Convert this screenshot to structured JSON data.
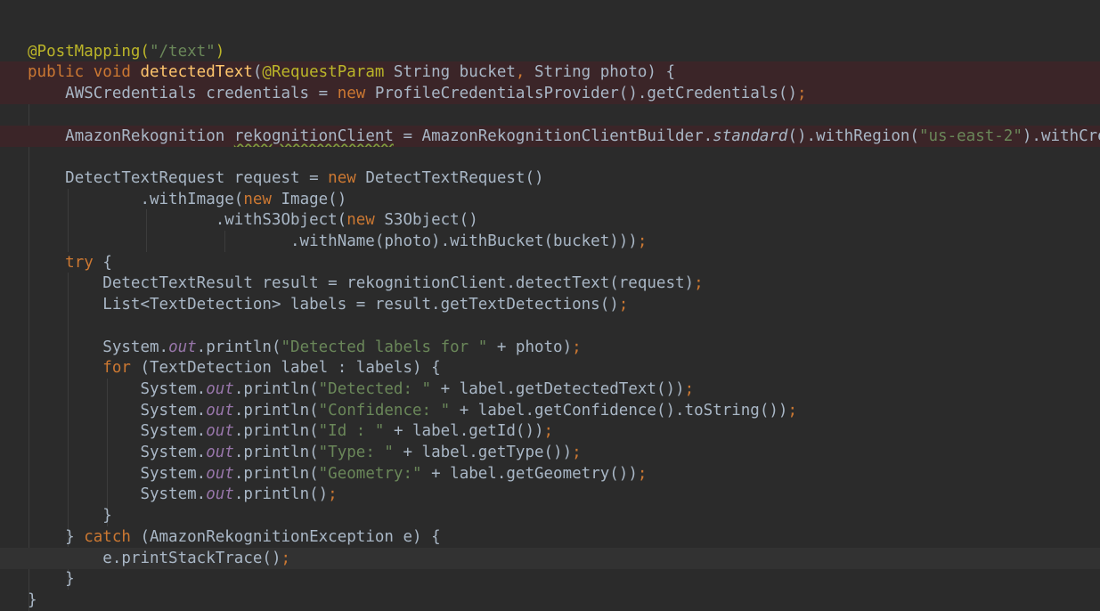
{
  "editor": {
    "lines": [
      {
        "indent": "",
        "tokens": []
      },
      {
        "indent": "",
        "tokens": [
          {
            "t": "@PostMapping(",
            "c": "ann"
          },
          {
            "t": "\"/text\"",
            "c": "str"
          },
          {
            "t": ")",
            "c": "ann"
          }
        ]
      },
      {
        "indent": "",
        "hl": "err",
        "tokens": [
          {
            "t": "public void ",
            "c": "kw"
          },
          {
            "t": "detectedText",
            "c": "fn"
          },
          {
            "t": "(",
            "c": ""
          },
          {
            "t": "@RequestParam",
            "c": "ann"
          },
          {
            "t": " String bucket",
            "c": ""
          },
          {
            "t": ", ",
            "c": "kw"
          },
          {
            "t": "String photo) {",
            "c": ""
          }
        ]
      },
      {
        "indent": "    ",
        "hl": "err",
        "tokens": [
          {
            "t": "AWSCredentials credentials = ",
            "c": ""
          },
          {
            "t": "new ",
            "c": "kw"
          },
          {
            "t": "ProfileCredentialsProvider().getCredentials()",
            "c": ""
          },
          {
            "t": ";",
            "c": "kw"
          }
        ]
      },
      {
        "indent": "",
        "tokens": []
      },
      {
        "indent": "    ",
        "hl": "err",
        "tokens": [
          {
            "t": "AmazonRekognition ",
            "c": ""
          },
          {
            "t": "rekognitionClient",
            "c": "warn"
          },
          {
            "t": " = AmazonRekognitionClientBuilder.",
            "c": ""
          },
          {
            "t": "standard",
            "c": "ital"
          },
          {
            "t": "().withRegion(",
            "c": ""
          },
          {
            "t": "\"us-east-2\"",
            "c": "str"
          },
          {
            "t": ").withCredentials(",
            "c": ""
          }
        ]
      },
      {
        "indent": "",
        "tokens": []
      },
      {
        "indent": "    ",
        "tokens": [
          {
            "t": "DetectTextRequest request = ",
            "c": ""
          },
          {
            "t": "new ",
            "c": "kw"
          },
          {
            "t": "DetectTextRequest()",
            "c": ""
          }
        ]
      },
      {
        "indent": "            ",
        "tokens": [
          {
            "t": ".withImage(",
            "c": ""
          },
          {
            "t": "new ",
            "c": "kw"
          },
          {
            "t": "Image()",
            "c": ""
          }
        ]
      },
      {
        "indent": "                    ",
        "tokens": [
          {
            "t": ".withS3Object(",
            "c": ""
          },
          {
            "t": "new ",
            "c": "kw"
          },
          {
            "t": "S3Object()",
            "c": ""
          }
        ]
      },
      {
        "indent": "                            ",
        "tokens": [
          {
            "t": ".withName(photo).withBucket(bucket)))",
            "c": ""
          },
          {
            "t": ";",
            "c": "kw"
          }
        ]
      },
      {
        "indent": "    ",
        "tokens": [
          {
            "t": "try ",
            "c": "kw"
          },
          {
            "t": "{",
            "c": ""
          }
        ]
      },
      {
        "indent": "        ",
        "tokens": [
          {
            "t": "DetectTextResult result = rekognitionClient.detectText(request)",
            "c": ""
          },
          {
            "t": ";",
            "c": "kw"
          }
        ]
      },
      {
        "indent": "        ",
        "tokens": [
          {
            "t": "List<TextDetection> labels = result.getTextDetections()",
            "c": ""
          },
          {
            "t": ";",
            "c": "kw"
          }
        ]
      },
      {
        "indent": "",
        "tokens": []
      },
      {
        "indent": "        ",
        "tokens": [
          {
            "t": "System.",
            "c": ""
          },
          {
            "t": "out",
            "c": "fld"
          },
          {
            "t": ".println(",
            "c": ""
          },
          {
            "t": "\"Detected labels for \"",
            "c": "str"
          },
          {
            "t": " + photo)",
            "c": ""
          },
          {
            "t": ";",
            "c": "kw"
          }
        ]
      },
      {
        "indent": "        ",
        "tokens": [
          {
            "t": "for ",
            "c": "kw"
          },
          {
            "t": "(TextDetection label : labels) {",
            "c": ""
          }
        ]
      },
      {
        "indent": "            ",
        "tokens": [
          {
            "t": "System.",
            "c": ""
          },
          {
            "t": "out",
            "c": "fld"
          },
          {
            "t": ".println(",
            "c": ""
          },
          {
            "t": "\"Detected: \"",
            "c": "str"
          },
          {
            "t": " + label.getDetectedText())",
            "c": ""
          },
          {
            "t": ";",
            "c": "kw"
          }
        ]
      },
      {
        "indent": "            ",
        "tokens": [
          {
            "t": "System.",
            "c": ""
          },
          {
            "t": "out",
            "c": "fld"
          },
          {
            "t": ".println(",
            "c": ""
          },
          {
            "t": "\"Confidence: \"",
            "c": "str"
          },
          {
            "t": " + label.getConfidence().toString())",
            "c": ""
          },
          {
            "t": ";",
            "c": "kw"
          }
        ]
      },
      {
        "indent": "            ",
        "tokens": [
          {
            "t": "System.",
            "c": ""
          },
          {
            "t": "out",
            "c": "fld"
          },
          {
            "t": ".println(",
            "c": ""
          },
          {
            "t": "\"Id : \"",
            "c": "str"
          },
          {
            "t": " + label.getId())",
            "c": ""
          },
          {
            "t": ";",
            "c": "kw"
          }
        ]
      },
      {
        "indent": "            ",
        "tokens": [
          {
            "t": "System.",
            "c": ""
          },
          {
            "t": "out",
            "c": "fld"
          },
          {
            "t": ".println(",
            "c": ""
          },
          {
            "t": "\"Type: \"",
            "c": "str"
          },
          {
            "t": " + label.getType())",
            "c": ""
          },
          {
            "t": ";",
            "c": "kw"
          }
        ]
      },
      {
        "indent": "            ",
        "tokens": [
          {
            "t": "System.",
            "c": ""
          },
          {
            "t": "out",
            "c": "fld"
          },
          {
            "t": ".println(",
            "c": ""
          },
          {
            "t": "\"Geometry:\"",
            "c": "str"
          },
          {
            "t": " + label.getGeometry())",
            "c": ""
          },
          {
            "t": ";",
            "c": "kw"
          }
        ]
      },
      {
        "indent": "            ",
        "tokens": [
          {
            "t": "System.",
            "c": ""
          },
          {
            "t": "out",
            "c": "fld"
          },
          {
            "t": ".println()",
            "c": ""
          },
          {
            "t": ";",
            "c": "kw"
          }
        ]
      },
      {
        "indent": "        ",
        "tokens": [
          {
            "t": "}",
            "c": ""
          }
        ]
      },
      {
        "indent": "    ",
        "tokens": [
          {
            "t": "} ",
            "c": ""
          },
          {
            "t": "catch ",
            "c": "kw"
          },
          {
            "t": "(AmazonRekognitionException e) {",
            "c": ""
          }
        ]
      },
      {
        "indent": "        ",
        "hl": "cur",
        "tokens": [
          {
            "t": "e.printStackTrace()",
            "c": ""
          },
          {
            "t": ";",
            "c": "kw"
          }
        ]
      },
      {
        "indent": "    ",
        "tokens": [
          {
            "t": "}",
            "c": ""
          }
        ]
      },
      {
        "indent": "",
        "tokens": [
          {
            "t": "}",
            "c": ""
          }
        ]
      }
    ]
  }
}
